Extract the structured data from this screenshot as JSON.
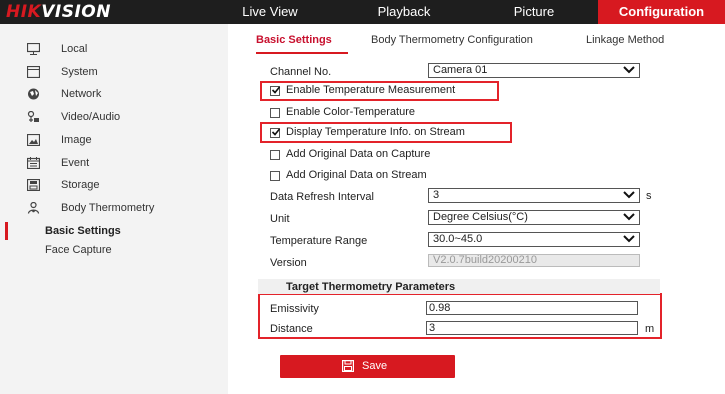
{
  "brand": {
    "logo_red": "HIK",
    "logo_white": "VISION"
  },
  "top_nav": {
    "live_view": "Live View",
    "playback": "Playback",
    "picture": "Picture",
    "configuration": "Configuration"
  },
  "sidebar": {
    "items": [
      {
        "label": "Local",
        "icon": "monitor-icon"
      },
      {
        "label": "System",
        "icon": "system-icon"
      },
      {
        "label": "Network",
        "icon": "globe-icon"
      },
      {
        "label": "Video/Audio",
        "icon": "video-audio-icon"
      },
      {
        "label": "Image",
        "icon": "image-icon"
      },
      {
        "label": "Event",
        "icon": "calendar-icon"
      },
      {
        "label": "Storage",
        "icon": "storage-icon"
      },
      {
        "label": "Body Thermometry",
        "icon": "thermometry-icon"
      }
    ],
    "sub_items": [
      {
        "label": "Basic Settings",
        "active": true
      },
      {
        "label": "Face Capture",
        "active": false
      }
    ]
  },
  "tabs": {
    "basic_settings": "Basic Settings",
    "body_thermometry_configuration": "Body Thermometry Configuration",
    "linkage_method": "Linkage Method"
  },
  "form": {
    "channel_label": "Channel No.",
    "channel_value": "Camera 01",
    "enable_temp_measurement": {
      "label": "Enable Temperature Measurement",
      "checked": true
    },
    "enable_color_temperature": {
      "label": "Enable Color-Temperature",
      "checked": false
    },
    "display_temp_info": {
      "label": "Display Temperature Info. on Stream",
      "checked": true
    },
    "add_data_capture": {
      "label": "Add Original Data on Capture",
      "checked": false
    },
    "add_data_stream": {
      "label": "Add Original Data on Stream",
      "checked": false
    },
    "refresh_label": "Data Refresh Interval",
    "refresh_value": "3",
    "refresh_unit": "s",
    "unit_label": "Unit",
    "unit_value": "Degree Celsius(°C)",
    "range_label": "Temperature Range",
    "range_value": "30.0~45.0",
    "version_label": "Version",
    "version_value": "V2.0.7build20200210"
  },
  "target_params": {
    "title": "Target Thermometry Parameters",
    "emissivity_label": "Emissivity",
    "emissivity_value": "0.98",
    "distance_label": "Distance",
    "distance_value": "3",
    "distance_unit": "m"
  },
  "save_button": {
    "label": "Save",
    "icon": "save-icon"
  },
  "colors": {
    "accent": "#d71920",
    "topbar": "#1e1e1e",
    "highlight": "#e3232a"
  }
}
